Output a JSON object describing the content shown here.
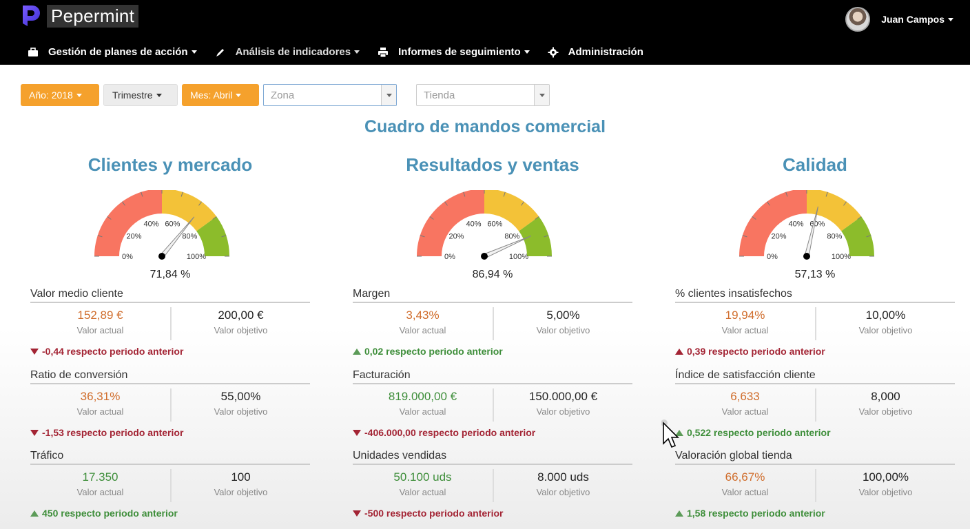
{
  "app": {
    "name": "Pepermint"
  },
  "user": {
    "name": "Juan Campos"
  },
  "nav": [
    {
      "label": "Gestión de planes de acción",
      "icon": "briefcase-icon"
    },
    {
      "label": "Análisis de indicadores",
      "icon": "pencil-icon"
    },
    {
      "label": "Informes de seguimiento",
      "icon": "print-icon"
    },
    {
      "label": "Administración",
      "icon": "gear-icon"
    }
  ],
  "filters": {
    "year": "Año: 2018",
    "quarter": "Trimestre",
    "month": "Mes: Abril",
    "zona_placeholder": "Zona",
    "tienda_placeholder": "Tienda"
  },
  "colors": {
    "orange": "#f5a12c",
    "title_blue": "#4a91b6",
    "gauge_red": "#f87561",
    "gauge_yellow": "#f3c238",
    "gauge_green": "#8cbc2b"
  },
  "page_title": "Cuadro de mandos comercial",
  "gauge_ticks": [
    "0%",
    "20%",
    "40%",
    "60%",
    "80%",
    "100%"
  ],
  "labels": {
    "actual": "Valor actual",
    "target": "Valor objetivo"
  },
  "columns": [
    {
      "title": "Clientes y mercado",
      "gauge_percent": 71.84,
      "gauge_label": "71,84 %",
      "kpis": [
        {
          "name": "Valor medio cliente",
          "actual": "152,89 €",
          "actual_color": "orange",
          "target": "200,00 €",
          "delta": "-0,44 respecto periodo anterior",
          "delta_dir": "down"
        },
        {
          "name": "Ratio de conversión",
          "actual": "36,31%",
          "actual_color": "orange",
          "target": "55,00%",
          "delta": "-1,53 respecto periodo anterior",
          "delta_dir": "down"
        },
        {
          "name": "Tráfico",
          "actual": "17.350",
          "actual_color": "green",
          "target": "100",
          "delta": "450 respecto periodo anterior",
          "delta_dir": "up-good"
        }
      ]
    },
    {
      "title": "Resultados y ventas",
      "gauge_percent": 86.94,
      "gauge_label": "86,94 %",
      "kpis": [
        {
          "name": "Margen",
          "actual": "3,43%",
          "actual_color": "orange",
          "target": "5,00%",
          "delta": "0,02 respecto periodo anterior",
          "delta_dir": "up-good"
        },
        {
          "name": "Facturación",
          "actual": "819.000,00 €",
          "actual_color": "green",
          "target": "150.000,00 €",
          "delta": "-406.000,00 respecto periodo anterior",
          "delta_dir": "down"
        },
        {
          "name": "Unidades vendidas",
          "actual": "50.100 uds",
          "actual_color": "green",
          "target": "8.000 uds",
          "delta": "-500 respecto periodo anterior",
          "delta_dir": "down"
        }
      ]
    },
    {
      "title": "Calidad",
      "gauge_percent": 57.13,
      "gauge_label": "57,13 %",
      "kpis": [
        {
          "name": "% clientes insatisfechos",
          "actual": "19,94%",
          "actual_color": "orange",
          "target": "10,00%",
          "delta": "0,39 respecto periodo anterior",
          "delta_dir": "up-bad"
        },
        {
          "name": "Índice de satisfacción cliente",
          "actual": "6,633",
          "actual_color": "orange",
          "target": "8,000",
          "delta": "0,522 respecto periodo anterior",
          "delta_dir": "up-good"
        },
        {
          "name": "Valoración global tienda",
          "actual": "66,67%",
          "actual_color": "orange",
          "target": "100,00%",
          "delta": "1,58 respecto periodo anterior",
          "delta_dir": "up-good"
        }
      ]
    }
  ]
}
